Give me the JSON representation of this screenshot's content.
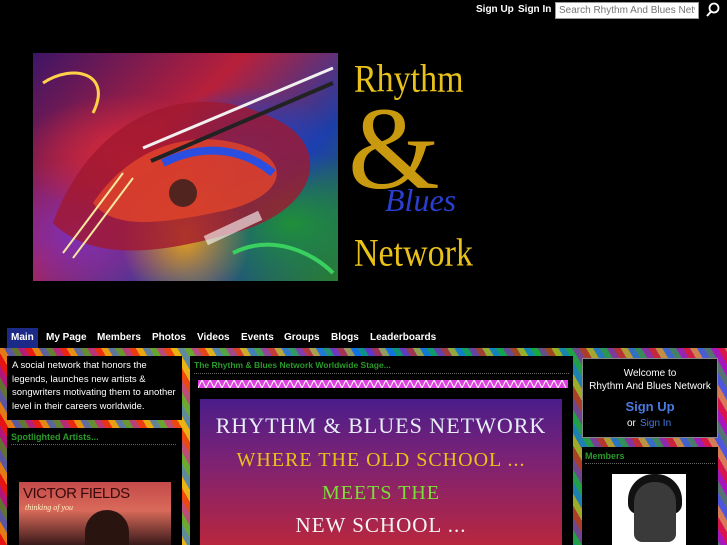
{
  "topbar": {
    "signup_label": "Sign Up",
    "signin_label": "Sign In",
    "search_placeholder": "Search Rhythm And Blues Netwo",
    "search_icon": "search-icon"
  },
  "logo": {
    "line1": "Rhythm",
    "amp": "&",
    "line2": "Blues",
    "line3": "Network"
  },
  "nav": {
    "items": [
      "Main",
      "My Page",
      "Members",
      "Photos",
      "Videos",
      "Events",
      "Groups",
      "Blogs",
      "Leaderboards"
    ],
    "active": "Main"
  },
  "left": {
    "intro": "A social network that honors the legends, launches new artists & songwriters motivating them to another level in their careers worldwide.",
    "spotlight_heading": "Spotlighted Artists...",
    "artist_image_title": "VICTOR FIELDS",
    "artist_image_subtitle": "thinking of you"
  },
  "center": {
    "heading": "The Rhythm & Blues Network Worldwide Stage...",
    "graphic_line1": "RHYTHM & BLUES NETWORK",
    "graphic_line2": "WHERE THE OLD SCHOOL ...",
    "graphic_line3": "MEETS THE",
    "graphic_line4": "NEW SCHOOL ..."
  },
  "right": {
    "welcome_line1": "Welcome to",
    "welcome_line2": "Rhythm And Blues Network",
    "signup_label": "Sign Up",
    "or_text": "or",
    "signin_label": "Sign In",
    "members_heading": "Members"
  },
  "colors": {
    "accent_green": "#2a9a2a",
    "link_blue": "#4a7adf",
    "nav_active": "#1b2a86",
    "logo_gold": "#e8c21a",
    "logo_blue": "#2a3fd0"
  }
}
